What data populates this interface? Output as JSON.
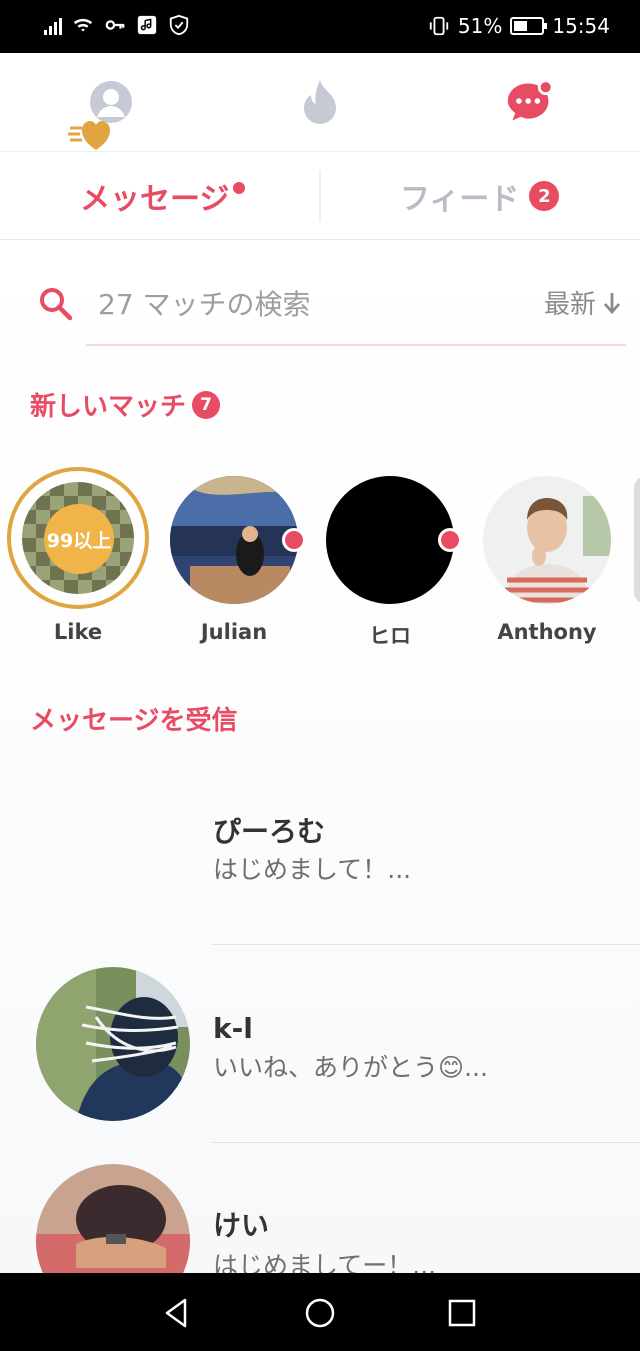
{
  "status_bar": {
    "battery": "51%",
    "battery_level": 0.51,
    "time": "15:54"
  },
  "top_nav": {
    "icons": [
      "profile-icon",
      "flame-icon",
      "messages-icon"
    ],
    "active": "messages-icon",
    "accent": "#e74c63",
    "inactive_color": "#c5cad4"
  },
  "tabs": [
    {
      "label": "メッセージ",
      "active": true
    },
    {
      "label": "フィード",
      "badge": "2",
      "active": false
    }
  ],
  "search": {
    "placeholder": "27 マッチの検索",
    "sort_label": "最新"
  },
  "new_matches": {
    "title": "新しいマッチ",
    "badge": "7",
    "likes": {
      "count": "99以上",
      "name": "Like"
    },
    "items": [
      {
        "name": "Julian",
        "unread": true
      },
      {
        "name": "ヒロ",
        "unread": true
      },
      {
        "name": "Anthony",
        "unread": false
      }
    ]
  },
  "messages": {
    "title": "メッセージを受信",
    "items": [
      {
        "name": "ぴーろむ",
        "preview": "はじめまして！..."
      },
      {
        "name": "k-l",
        "preview": "いいね、ありがとう😊..."
      },
      {
        "name": "けい",
        "preview": "はじめましてー！..."
      }
    ]
  }
}
